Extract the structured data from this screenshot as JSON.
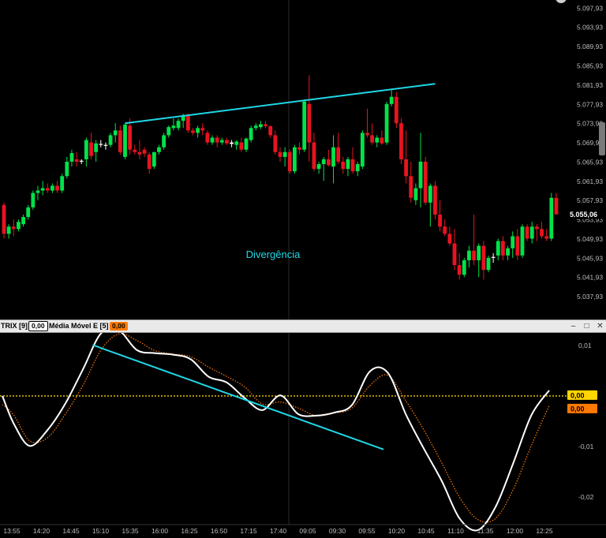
{
  "chart_data": [
    {
      "type": "candlestick",
      "title": "",
      "ylabels": [
        "5.097,93",
        "5.093,93",
        "5.089,93",
        "5.085,93",
        "5.081,93",
        "5.077,93",
        "5.073,93",
        "5.069,93",
        "5.065,93",
        "5.061,93",
        "5.057,93",
        "5.053,93",
        "5.049,93",
        "5.045,93",
        "5.041,93",
        "5.037,93"
      ],
      "yticks": [
        5097.93,
        5093.93,
        5089.93,
        5085.93,
        5081.93,
        5077.93,
        5073.93,
        5069.93,
        5065.93,
        5061.93,
        5057.93,
        5053.93,
        5049.93,
        5045.93,
        5041.93,
        5037.93
      ],
      "ylim": [
        5034.5,
        5099.3
      ],
      "last_price": 5055.06,
      "last_price_label": "5.055,06",
      "annotation": "Divergência",
      "trendline": {
        "start": [
          25,
          5074.0
        ],
        "end": [
          89,
          5082.2
        ]
      },
      "candles": [
        [
          5057,
          5057.5,
          5050,
          5051
        ],
        [
          5051,
          5053,
          5050,
          5052.5
        ],
        [
          5052.5,
          5054,
          5050.5,
          5052
        ],
        [
          5052,
          5054,
          5051.5,
          5053.5
        ],
        [
          5053,
          5055,
          5052.5,
          5054.5
        ],
        [
          5054.5,
          5057,
          5054,
          5056.5
        ],
        [
          5056.5,
          5060,
          5056,
          5059.5
        ],
        [
          5059.5,
          5061,
          5058,
          5060
        ],
        [
          5060,
          5062,
          5059,
          5060.5
        ],
        [
          5060.5,
          5061.5,
          5059.5,
          5060
        ],
        [
          5060,
          5061.5,
          5059.5,
          5061
        ],
        [
          5061,
          5062,
          5059.5,
          5060
        ],
        [
          5060,
          5063.5,
          5059.5,
          5063
        ],
        [
          5063,
          5067,
          5062.5,
          5066
        ],
        [
          5066,
          5068.5,
          5065,
          5067.8
        ],
        [
          5066.5,
          5068,
          5065,
          5066
        ],
        [
          5066,
          5066.5,
          5065.5,
          5066.2
        ],
        [
          5066.5,
          5071,
          5065,
          5070.5
        ],
        [
          5070,
          5072,
          5066.5,
          5067.2
        ],
        [
          5068,
          5070.5,
          5066,
          5069.8
        ],
        [
          5069.5,
          5070.5,
          5069,
          5069.7
        ],
        [
          5069.5,
          5070,
          5068.5,
          5069.3
        ],
        [
          5069.5,
          5072,
          5069,
          5071.5
        ],
        [
          5071.5,
          5074,
          5070,
          5072.5
        ],
        [
          5072.5,
          5073.5,
          5067.5,
          5068
        ],
        [
          5067,
          5074,
          5066.5,
          5073.7
        ],
        [
          5073.5,
          5075,
          5067.5,
          5068.5
        ],
        [
          5068.5,
          5069.5,
          5067.5,
          5068
        ],
        [
          5068,
          5070.5,
          5066.5,
          5067.5
        ],
        [
          5068.5,
          5069,
          5067,
          5067.7
        ],
        [
          5067.5,
          5068,
          5063.5,
          5064.5
        ],
        [
          5065,
          5068,
          5064.5,
          5068
        ],
        [
          5068,
          5069.5,
          5067.5,
          5069
        ],
        [
          5069,
          5072,
          5068.5,
          5071.5
        ],
        [
          5071.5,
          5073.5,
          5071,
          5073.2
        ],
        [
          5073,
          5075,
          5072.5,
          5073.5
        ],
        [
          5073,
          5075,
          5072.5,
          5074.5
        ],
        [
          5074.5,
          5076,
          5073,
          5075.5
        ],
        [
          5075.5,
          5076,
          5072,
          5072.5
        ],
        [
          5072.5,
          5073,
          5071.5,
          5072
        ],
        [
          5072,
          5073.5,
          5071,
          5073
        ],
        [
          5073,
          5074,
          5071.5,
          5072.5
        ],
        [
          5072,
          5072.5,
          5069.5,
          5070
        ],
        [
          5070,
          5071.5,
          5069.5,
          5071
        ],
        [
          5071,
          5071.5,
          5069,
          5070
        ],
        [
          5070,
          5071,
          5069.5,
          5070.5
        ],
        [
          5070.5,
          5071,
          5069.5,
          5069.8
        ],
        [
          5070,
          5070.5,
          5069,
          5069.7
        ],
        [
          5069.5,
          5070.5,
          5068.5,
          5070.2
        ],
        [
          5070,
          5071,
          5068,
          5068.5
        ],
        [
          5068.5,
          5071,
          5068,
          5070.8
        ],
        [
          5070.5,
          5073.5,
          5070,
          5073
        ],
        [
          5073,
          5074,
          5072.5,
          5073.5
        ],
        [
          5073.2,
          5074.5,
          5072.8,
          5073.8
        ],
        [
          5073.8,
          5074.5,
          5073,
          5073.4
        ],
        [
          5073.4,
          5073.5,
          5071,
          5071.5
        ],
        [
          5071.5,
          5072.5,
          5067.5,
          5068
        ],
        [
          5068,
          5069,
          5066,
          5067
        ],
        [
          5067,
          5069,
          5065,
          5068
        ],
        [
          5068,
          5068.5,
          5063.5,
          5064
        ],
        [
          5064,
          5069.5,
          5063.5,
          5069
        ],
        [
          5069,
          5070,
          5067.5,
          5068.5
        ],
        [
          5068.5,
          5079,
          5068,
          5078.5
        ],
        [
          5078,
          5084,
          5066,
          5070
        ],
        [
          5070,
          5072,
          5064,
          5064.5
        ],
        [
          5064.5,
          5066,
          5063.5,
          5065.5
        ],
        [
          5065.5,
          5067,
          5062,
          5066.5
        ],
        [
          5066.5,
          5068.5,
          5065,
          5065.3
        ],
        [
          5065,
          5071.5,
          5061.5,
          5069
        ],
        [
          5069,
          5072,
          5065.5,
          5066
        ],
        [
          5066,
          5067,
          5063.5,
          5064.5
        ],
        [
          5064.5,
          5067,
          5063,
          5066.5
        ],
        [
          5066.5,
          5069,
          5063.5,
          5064
        ],
        [
          5064,
          5066,
          5063,
          5065.5
        ],
        [
          5065,
          5072.5,
          5064.5,
          5072
        ],
        [
          5072,
          5077,
          5071,
          5071.5
        ],
        [
          5071.5,
          5074,
          5069.5,
          5070
        ],
        [
          5070,
          5071.5,
          5069,
          5071
        ],
        [
          5071,
          5072.5,
          5069.5,
          5069.8
        ],
        [
          5070,
          5078.5,
          5069.5,
          5078
        ],
        [
          5078,
          5081,
          5077.5,
          5079.5
        ],
        [
          5079.5,
          5080.5,
          5073,
          5074
        ],
        [
          5074,
          5075,
          5065.5,
          5066.5
        ],
        [
          5066.5,
          5072.5,
          5061.5,
          5063
        ],
        [
          5063,
          5066,
          5057.5,
          5058.5
        ],
        [
          5058,
          5061.5,
          5057,
          5060.5
        ],
        [
          5060.5,
          5072,
          5056.5,
          5066
        ],
        [
          5066,
          5067,
          5057,
          5057.5
        ],
        [
          5057.5,
          5061.5,
          5052.5,
          5061
        ],
        [
          5061,
          5062,
          5054,
          5055
        ],
        [
          5055,
          5058,
          5051.5,
          5052.5
        ],
        [
          5052.5,
          5054,
          5050.5,
          5051
        ],
        [
          5051,
          5052.5,
          5048.5,
          5049
        ],
        [
          5049,
          5052,
          5043.5,
          5044.5
        ],
        [
          5044.5,
          5047,
          5041.5,
          5042.5
        ],
        [
          5042.5,
          5046,
          5042,
          5045.5
        ],
        [
          5045.5,
          5048.5,
          5044,
          5047.5
        ],
        [
          5047.5,
          5055,
          5044.5,
          5045.5
        ],
        [
          5045.5,
          5049,
          5042,
          5048.5
        ],
        [
          5048.5,
          5049.5,
          5041.5,
          5043.5
        ],
        [
          5043.5,
          5046.5,
          5043,
          5046
        ],
        [
          5046,
          5047,
          5045,
          5046.2
        ],
        [
          5046.5,
          5050,
          5045.5,
          5049.5
        ],
        [
          5049.5,
          5050.5,
          5045.5,
          5046.5
        ],
        [
          5046.5,
          5048.5,
          5045.5,
          5048
        ],
        [
          5048,
          5051.5,
          5046,
          5050.5
        ],
        [
          5050.5,
          5052,
          5045.5,
          5046.5
        ],
        [
          5046.5,
          5053,
          5046,
          5052.5
        ],
        [
          5052.5,
          5053,
          5049.5,
          5050
        ],
        [
          5050,
          5053.5,
          5049,
          5052.5
        ],
        [
          5052.5,
          5053,
          5049.5,
          5052
        ],
        [
          5052,
          5053.5,
          5050,
          5050.5
        ],
        [
          5050.5,
          5052,
          5049.5,
          5050
        ],
        [
          5050,
          5059.5,
          5049.5,
          5058.5
        ],
        [
          5058.5,
          5059.5,
          5055,
          5055.06
        ]
      ]
    },
    {
      "type": "line",
      "title": "",
      "ylabels": [
        "0,01",
        "-0,01",
        "-0,02"
      ],
      "yticks": [
        0.01,
        -0.01,
        -0.02
      ],
      "ylim": [
        -0.0255,
        0.0125
      ],
      "xlabels": [
        "13:55",
        "14:20",
        "14:45",
        "15:10",
        "15:35",
        "16:00",
        "16:25",
        "16:50",
        "17:15",
        "17:40",
        "09:05",
        "09:30",
        "09:55",
        "10:20",
        "10:45",
        "11:10",
        "11:35",
        "12:00",
        "12:25"
      ],
      "zero_line": 0,
      "trendline": {
        "start": [
          22.9,
          0.0101
        ],
        "end": [
          96.6,
          -0.0106
        ]
      },
      "series": [
        {
          "name": "TRIX",
          "value_label": "0,00",
          "color": "#ffffff",
          "points": [
            [
              0,
              0
            ],
            [
              2.9,
              -0.0055
            ],
            [
              6.9,
              -0.0099
            ],
            [
              11.4,
              -0.0068
            ],
            [
              15.9,
              -0.0016
            ],
            [
              20.5,
              0.0054
            ],
            [
              25,
              0.0124
            ],
            [
              29.5,
              0.013
            ],
            [
              34.1,
              0.0091
            ],
            [
              38.6,
              0.0085
            ],
            [
              43.2,
              0.0082
            ],
            [
              47.7,
              0.0073
            ],
            [
              52.3,
              0.0038
            ],
            [
              56.8,
              0.0027
            ],
            [
              61.4,
              -0.0004
            ],
            [
              65.9,
              -0.0028
            ],
            [
              70.5,
              0.0001
            ],
            [
              75,
              -0.0036
            ],
            [
              79.5,
              -0.0039
            ],
            [
              84.1,
              -0.0033
            ],
            [
              88.6,
              -0.0018
            ],
            [
              93.2,
              0.0049
            ],
            [
              97.7,
              0.0046
            ],
            [
              102.3,
              -0.0037
            ],
            [
              106.8,
              -0.0104
            ],
            [
              111.4,
              -0.0169
            ],
            [
              115.9,
              -0.0243
            ],
            [
              120.5,
              -0.0266
            ],
            [
              125,
              -0.022
            ],
            [
              129.5,
              -0.0133
            ],
            [
              134.1,
              -0.0038
            ],
            [
              138.6,
              0.0011
            ]
          ]
        },
        {
          "name": "Média Móvel E [5]",
          "value_label": "0,00",
          "color": "#ff7a00",
          "points": [
            [
              0,
              -0.0017
            ],
            [
              2.9,
              -0.0038
            ],
            [
              6.9,
              -0.0089
            ],
            [
              11.4,
              -0.0083
            ],
            [
              15.9,
              -0.0037
            ],
            [
              20.5,
              0.0022
            ],
            [
              25,
              0.0091
            ],
            [
              29.5,
              0.0123
            ],
            [
              34.1,
              0.011
            ],
            [
              38.6,
              0.009
            ],
            [
              43.2,
              0.0083
            ],
            [
              47.7,
              0.0078
            ],
            [
              52.3,
              0.0057
            ],
            [
              56.8,
              0.0039
            ],
            [
              61.4,
              0.0018
            ],
            [
              65.9,
              -0.0016
            ],
            [
              70.5,
              -0.0012
            ],
            [
              75,
              -0.0024
            ],
            [
              79.5,
              -0.0039
            ],
            [
              84.1,
              -0.0034
            ],
            [
              88.6,
              -0.0024
            ],
            [
              93.2,
              0.0021
            ],
            [
              97.7,
              0.0041
            ],
            [
              102.3,
              -0.001
            ],
            [
              106.8,
              -0.0067
            ],
            [
              111.4,
              -0.0133
            ],
            [
              115.9,
              -0.0201
            ],
            [
              120.5,
              -0.0245
            ],
            [
              125,
              -0.0243
            ],
            [
              129.5,
              -0.0185
            ],
            [
              134.1,
              -0.0098
            ],
            [
              138.6,
              -0.0019
            ]
          ]
        }
      ]
    }
  ],
  "indicator_bar": {
    "trix_label": "TRIX [9]",
    "trix_value": "0,00",
    "ma_label": "Média Móvel E [5]",
    "ma_value": "0,00",
    "minimize": "–",
    "maximize": "□",
    "close": "✕"
  },
  "colors": {
    "up": "#00e34a",
    "down": "#e8141f",
    "doji": "#ffffff",
    "trend": "#20d7e6",
    "zero": "#f5d000",
    "trix": "#ffffff",
    "ma": "#ff7a00"
  }
}
